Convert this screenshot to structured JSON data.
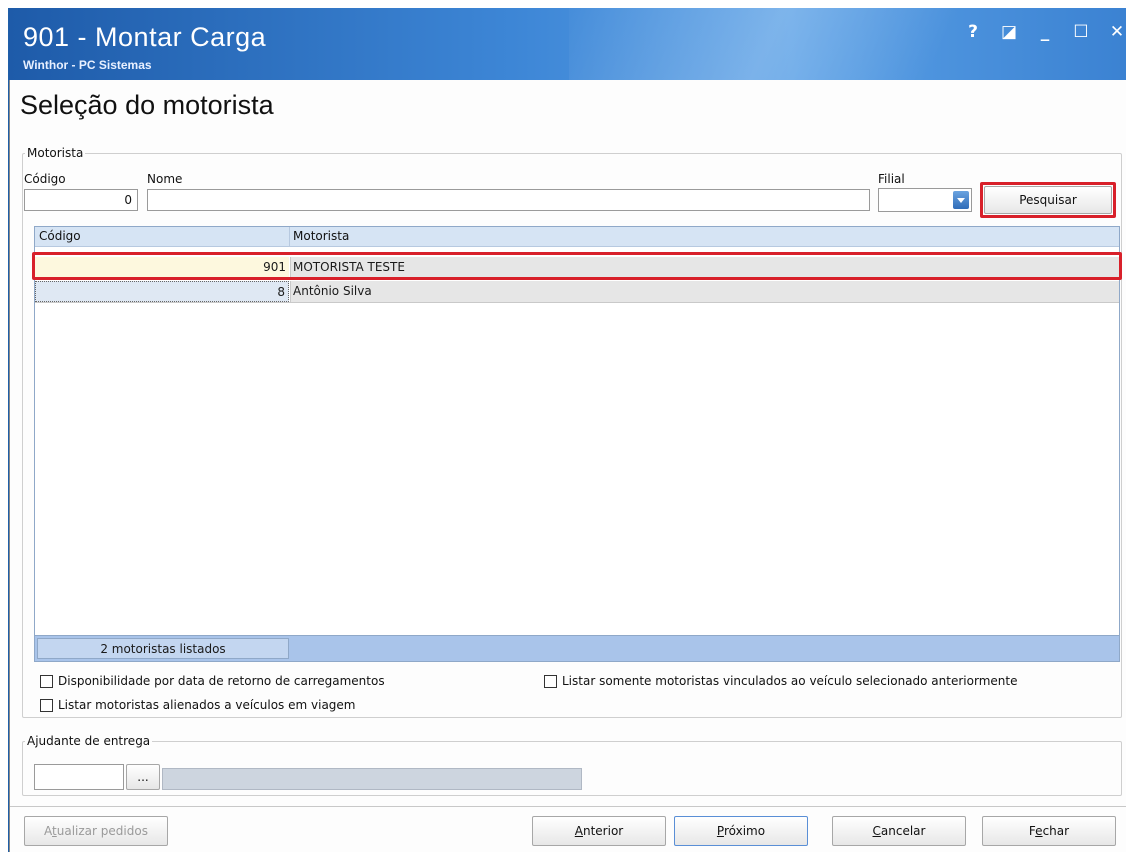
{
  "window": {
    "title": "901 - Montar Carga",
    "subtitle": "Winthor - PC Sistemas",
    "controls": {
      "help": "?",
      "restore": "◪",
      "minimize": "_",
      "maximize": "☐",
      "close": "✕"
    }
  },
  "page": {
    "title": "Seleção do motorista"
  },
  "motorista": {
    "legend": "Motorista",
    "codigo_label": "Código",
    "codigo_value": "0",
    "nome_label": "Nome",
    "nome_value": "",
    "filial_label": "Filial",
    "filial_value": "",
    "pesquisar_label": "Pesquisar"
  },
  "grid": {
    "columns": [
      "Código",
      "Motorista"
    ],
    "rows": [
      {
        "codigo": "901",
        "motorista": "MOTORISTA TESTE"
      },
      {
        "codigo": "8",
        "motorista": "Antônio Silva"
      }
    ],
    "footer": "2 motoristas listados"
  },
  "options": {
    "disponibilidade": "Disponibilidade por data de retorno de carregamentos",
    "alienados": "Listar motoristas alienados a veículos em viagem",
    "vinculados": "Listar somente motoristas vinculados ao veículo selecionado anteriormente"
  },
  "ajudante": {
    "legend": "Ajudante de entrega",
    "code_value": "",
    "lookup_label": "...",
    "name_value": ""
  },
  "footer_buttons": {
    "atualizar": {
      "before": "A",
      "accel": "t",
      "after": "ualizar pedidos"
    },
    "anterior": {
      "before": "",
      "accel": "A",
      "after": "nterior"
    },
    "proximo": {
      "before": "",
      "accel": "P",
      "after": "róximo"
    },
    "cancelar": {
      "before": "",
      "accel": "C",
      "after": "ancelar"
    },
    "fechar": {
      "before": "F",
      "accel": "e",
      "after": "char"
    }
  },
  "colors": {
    "titlebar": "#2f72c4",
    "highlight": "#d8202a",
    "grid_header": "#d6e4f4",
    "grid_footer": "#a9c4ea"
  }
}
